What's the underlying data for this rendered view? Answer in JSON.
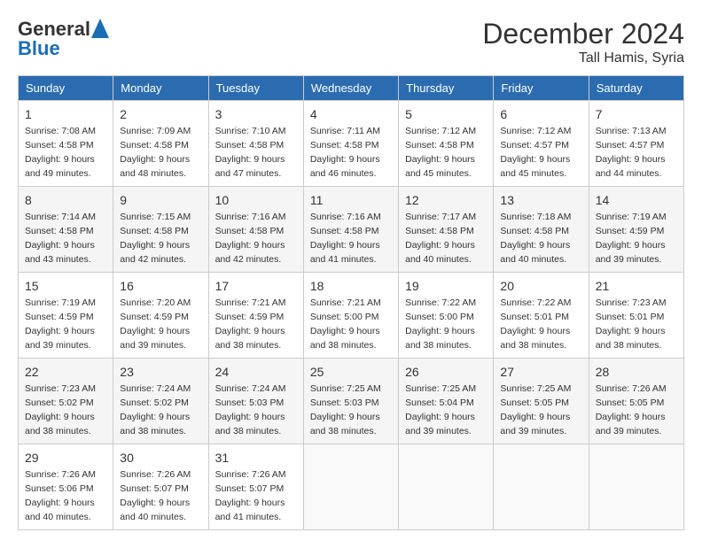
{
  "header": {
    "logo_general": "General",
    "logo_blue": "Blue",
    "month_title": "December 2024",
    "location": "Tall Hamis, Syria"
  },
  "columns": [
    "Sunday",
    "Monday",
    "Tuesday",
    "Wednesday",
    "Thursday",
    "Friday",
    "Saturday"
  ],
  "weeks": [
    [
      {
        "day": "1",
        "sunrise": "7:08 AM",
        "sunset": "4:58 PM",
        "daylight": "9 hours and 49 minutes."
      },
      {
        "day": "2",
        "sunrise": "7:09 AM",
        "sunset": "4:58 PM",
        "daylight": "9 hours and 48 minutes."
      },
      {
        "day": "3",
        "sunrise": "7:10 AM",
        "sunset": "4:58 PM",
        "daylight": "9 hours and 47 minutes."
      },
      {
        "day": "4",
        "sunrise": "7:11 AM",
        "sunset": "4:58 PM",
        "daylight": "9 hours and 46 minutes."
      },
      {
        "day": "5",
        "sunrise": "7:12 AM",
        "sunset": "4:58 PM",
        "daylight": "9 hours and 45 minutes."
      },
      {
        "day": "6",
        "sunrise": "7:12 AM",
        "sunset": "4:57 PM",
        "daylight": "9 hours and 45 minutes."
      },
      {
        "day": "7",
        "sunrise": "7:13 AM",
        "sunset": "4:57 PM",
        "daylight": "9 hours and 44 minutes."
      }
    ],
    [
      {
        "day": "8",
        "sunrise": "7:14 AM",
        "sunset": "4:58 PM",
        "daylight": "9 hours and 43 minutes."
      },
      {
        "day": "9",
        "sunrise": "7:15 AM",
        "sunset": "4:58 PM",
        "daylight": "9 hours and 42 minutes."
      },
      {
        "day": "10",
        "sunrise": "7:16 AM",
        "sunset": "4:58 PM",
        "daylight": "9 hours and 42 minutes."
      },
      {
        "day": "11",
        "sunrise": "7:16 AM",
        "sunset": "4:58 PM",
        "daylight": "9 hours and 41 minutes."
      },
      {
        "day": "12",
        "sunrise": "7:17 AM",
        "sunset": "4:58 PM",
        "daylight": "9 hours and 40 minutes."
      },
      {
        "day": "13",
        "sunrise": "7:18 AM",
        "sunset": "4:58 PM",
        "daylight": "9 hours and 40 minutes."
      },
      {
        "day": "14",
        "sunrise": "7:19 AM",
        "sunset": "4:59 PM",
        "daylight": "9 hours and 39 minutes."
      }
    ],
    [
      {
        "day": "15",
        "sunrise": "7:19 AM",
        "sunset": "4:59 PM",
        "daylight": "9 hours and 39 minutes."
      },
      {
        "day": "16",
        "sunrise": "7:20 AM",
        "sunset": "4:59 PM",
        "daylight": "9 hours and 39 minutes."
      },
      {
        "day": "17",
        "sunrise": "7:21 AM",
        "sunset": "4:59 PM",
        "daylight": "9 hours and 38 minutes."
      },
      {
        "day": "18",
        "sunrise": "7:21 AM",
        "sunset": "5:00 PM",
        "daylight": "9 hours and 38 minutes."
      },
      {
        "day": "19",
        "sunrise": "7:22 AM",
        "sunset": "5:00 PM",
        "daylight": "9 hours and 38 minutes."
      },
      {
        "day": "20",
        "sunrise": "7:22 AM",
        "sunset": "5:01 PM",
        "daylight": "9 hours and 38 minutes."
      },
      {
        "day": "21",
        "sunrise": "7:23 AM",
        "sunset": "5:01 PM",
        "daylight": "9 hours and 38 minutes."
      }
    ],
    [
      {
        "day": "22",
        "sunrise": "7:23 AM",
        "sunset": "5:02 PM",
        "daylight": "9 hours and 38 minutes."
      },
      {
        "day": "23",
        "sunrise": "7:24 AM",
        "sunset": "5:02 PM",
        "daylight": "9 hours and 38 minutes."
      },
      {
        "day": "24",
        "sunrise": "7:24 AM",
        "sunset": "5:03 PM",
        "daylight": "9 hours and 38 minutes."
      },
      {
        "day": "25",
        "sunrise": "7:25 AM",
        "sunset": "5:03 PM",
        "daylight": "9 hours and 38 minutes."
      },
      {
        "day": "26",
        "sunrise": "7:25 AM",
        "sunset": "5:04 PM",
        "daylight": "9 hours and 39 minutes."
      },
      {
        "day": "27",
        "sunrise": "7:25 AM",
        "sunset": "5:05 PM",
        "daylight": "9 hours and 39 minutes."
      },
      {
        "day": "28",
        "sunrise": "7:26 AM",
        "sunset": "5:05 PM",
        "daylight": "9 hours and 39 minutes."
      }
    ],
    [
      {
        "day": "29",
        "sunrise": "7:26 AM",
        "sunset": "5:06 PM",
        "daylight": "9 hours and 40 minutes."
      },
      {
        "day": "30",
        "sunrise": "7:26 AM",
        "sunset": "5:07 PM",
        "daylight": "9 hours and 40 minutes."
      },
      {
        "day": "31",
        "sunrise": "7:26 AM",
        "sunset": "5:07 PM",
        "daylight": "9 hours and 41 minutes."
      },
      null,
      null,
      null,
      null
    ]
  ]
}
